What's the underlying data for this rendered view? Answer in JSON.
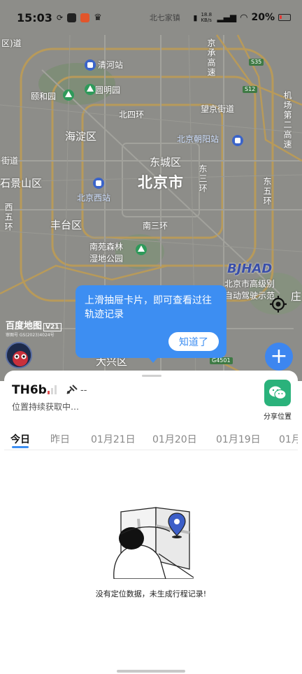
{
  "status_bar": {
    "time": "15:03",
    "carrier_text": "北七家镇",
    "network_speed": "18.8 KB/s",
    "battery": "20%"
  },
  "map": {
    "labels": {
      "l01": "区)道",
      "l02": "清河站",
      "l03": "颐和园",
      "l04": "圆明园",
      "l05": "北四环",
      "l06": "望京街道",
      "l07": "海淀区",
      "l08": "北京朝阳站",
      "l09": "街道",
      "l10": "东城区",
      "l11": "石景山区",
      "l12": "北京市",
      "l13": "北京西站",
      "l14": "丰台区",
      "l15": "南三环",
      "l16": "南苑森林",
      "l17": "湿地公园",
      "l18": "北京市高级别",
      "l19": "自动驾驶示范",
      "l20": "大兴区",
      "l21": "庄",
      "v01": "京承高速",
      "v02": "机场第二高速",
      "v03": "西五环",
      "v04": "东三环",
      "v05": "东五环"
    },
    "shields": {
      "s1": "S35",
      "s2": "S12",
      "s3": "G4501"
    },
    "logo": "百度地图",
    "logo_badge": "V21",
    "copyright": "审图号 GS(2023)4024号",
    "watermark": "BJHAD"
  },
  "tooltip": {
    "text": "上滑抽屉卡片，即可查看过往轨迹记录",
    "ok_label": "知道了"
  },
  "sheet": {
    "device_name": "TH6b",
    "gps_value": "--",
    "status_text": "位置持续获取中…",
    "share_label": "分享位置",
    "tabs": [
      "今日",
      "昨日",
      "01月21日",
      "01月20日",
      "01月19日",
      "01月"
    ],
    "active_tab_index": 0,
    "empty_message": "没有定位数据，未生成行程记录!"
  },
  "colors": {
    "accent": "#3d8ef2",
    "share_green": "#2ab27b",
    "map_gray": "#8e8e8a"
  }
}
